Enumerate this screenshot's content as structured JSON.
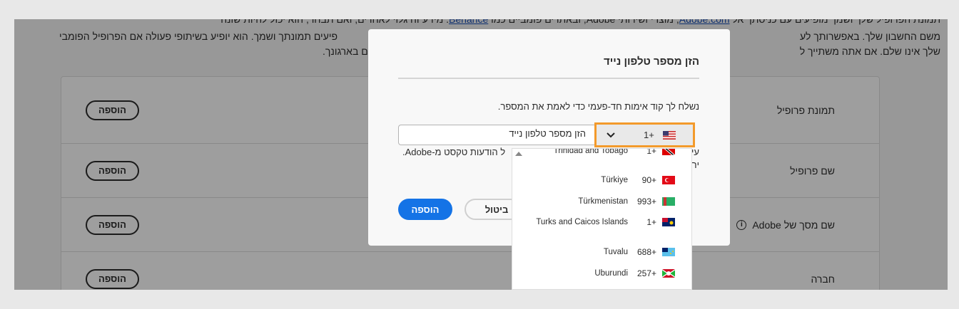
{
  "background": {
    "intro_line1": {
      "before": "תמונת הפרופיל שלך ושמך מופיעים עם כניסתך אל ",
      "link1": "Adobe.com",
      "middle": ", מוצרי ושירותי Adobe, ובאתרים פומביים כמו ",
      "link2": "Behance",
      "after": ". מידע זה גלוי לאחרים, ואם תבחר, הוא יכול להיות שונה"
    },
    "intro_line2_right": "משם החשבון שלך. באפשרותך לע",
    "intro_line2_left": "פיעים תמונתך ושמך. הוא יופיע בשיתופי פעולה אם הפרופיל הפומבי",
    "intro_line3_right": "שלך אינו שלם. אם אתה משתייך ל",
    "intro_line3_left": "ם בארגונך.",
    "rows": [
      {
        "label": "תמונת פרופיל",
        "button": "הוספה"
      },
      {
        "label": "שם פרופיל",
        "button": "הוספה"
      },
      {
        "label": "שם מסך של Adobe",
        "button": "הוספה",
        "info_icon": "i"
      },
      {
        "label": "חברה",
        "button": "הוספה"
      }
    ]
  },
  "modal": {
    "title": "הזן מספר טלפון נייד",
    "description": "נשלח לך קוד אימות חד-פעמי כדי לאמת את המספר.",
    "phone_placeholder": "הזן מספר טלפון נייד",
    "country_code": "1+",
    "helper_line1": "ל הודעות טקסט מ-Adobe.",
    "helper_right1": "עי",
    "helper_right2": "יר",
    "add_button": "הוספה",
    "cancel_button": "ביטול"
  },
  "country_dropdown": [
    {
      "name": "Trinidad and Tobago",
      "code": "1+"
    },
    {
      "name": "Türkiye",
      "code": "90+"
    },
    {
      "name": "Türkmenistan",
      "code": "993+"
    },
    {
      "name": "Turks and Caicos Islands",
      "code": "1+"
    },
    {
      "name": "Tuvalu",
      "code": "688+"
    },
    {
      "name": "Uburundi",
      "code": "257+"
    }
  ],
  "colors": {
    "accent": "#1473e6",
    "focus": "#f39a2b"
  }
}
